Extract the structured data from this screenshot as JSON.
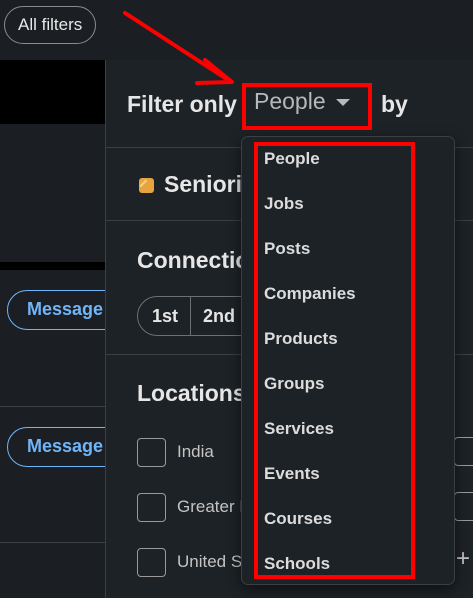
{
  "topbar": {
    "all_filters_label": "All filters"
  },
  "left": {
    "message_label": "Message"
  },
  "panel": {
    "filter_only_label": "Filter only",
    "type_selected": "People",
    "by_label": "by",
    "seniority_label": "Seniority",
    "connections_title": "Connections",
    "connection_options": [
      "1st",
      "2nd"
    ],
    "locations_title": "Locations",
    "locations": [
      "India",
      "Greater B",
      "United St"
    ]
  },
  "dropdown": {
    "items": [
      "People",
      "Jobs",
      "Posts",
      "Companies",
      "Products",
      "Groups",
      "Services",
      "Events",
      "Courses",
      "Schools"
    ]
  },
  "colors": {
    "annotation": "#ff0000",
    "accent": "#70b5f9",
    "bg": "#1b1f23"
  },
  "icons": {
    "seniority": "lock-icon",
    "dropdown_caret": "caret-down-icon",
    "add": "plus-icon"
  }
}
